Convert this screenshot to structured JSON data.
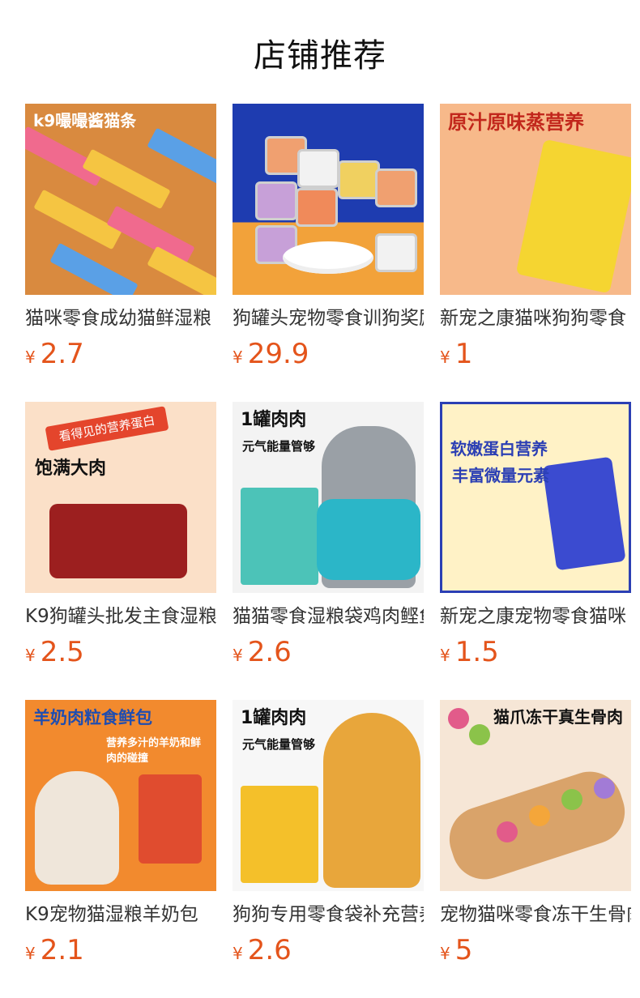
{
  "page": {
    "title": "店铺推荐"
  },
  "currency": "¥",
  "products": [
    {
      "name": "猫咪零食成幼猫鲜湿粮",
      "price": "2.7",
      "image_caption": "k9嘬嘬酱猫条"
    },
    {
      "name": "狗罐头宠物零食训狗奖励",
      "price": "29.9",
      "image_caption": ""
    },
    {
      "name": "新宠之康猫咪狗狗零食",
      "price": "1",
      "image_caption": "原汁原味蒸营养"
    },
    {
      "name": "K9狗罐头批发主食湿粮",
      "price": "2.5",
      "image_caption": "看得见的营养蛋白",
      "image_caption2": "饱满大肉"
    },
    {
      "name": "猫猫零食湿粮袋鸡肉鲣鱼",
      "price": "2.6",
      "image_caption": "1罐肉肉",
      "image_caption2": "元气能量管够"
    },
    {
      "name": "新宠之康宠物零食猫咪",
      "price": "1.5",
      "image_caption": "软嫩蛋白营养",
      "image_caption2": "丰富微量元素"
    },
    {
      "name": "K9宠物猫湿粮羊奶包",
      "price": "2.1",
      "image_caption": "羊奶肉粒食鲜包",
      "image_caption2": "营养多汁的羊奶和鲜肉的碰撞"
    },
    {
      "name": "狗狗专用零食袋补充营养",
      "price": "2.6",
      "image_caption": "1罐肉肉",
      "image_caption2": "元气能量管够"
    },
    {
      "name": "宠物猫咪零食冻干生骨肉",
      "price": "5",
      "image_caption": "猫爪冻干真生骨肉"
    }
  ]
}
